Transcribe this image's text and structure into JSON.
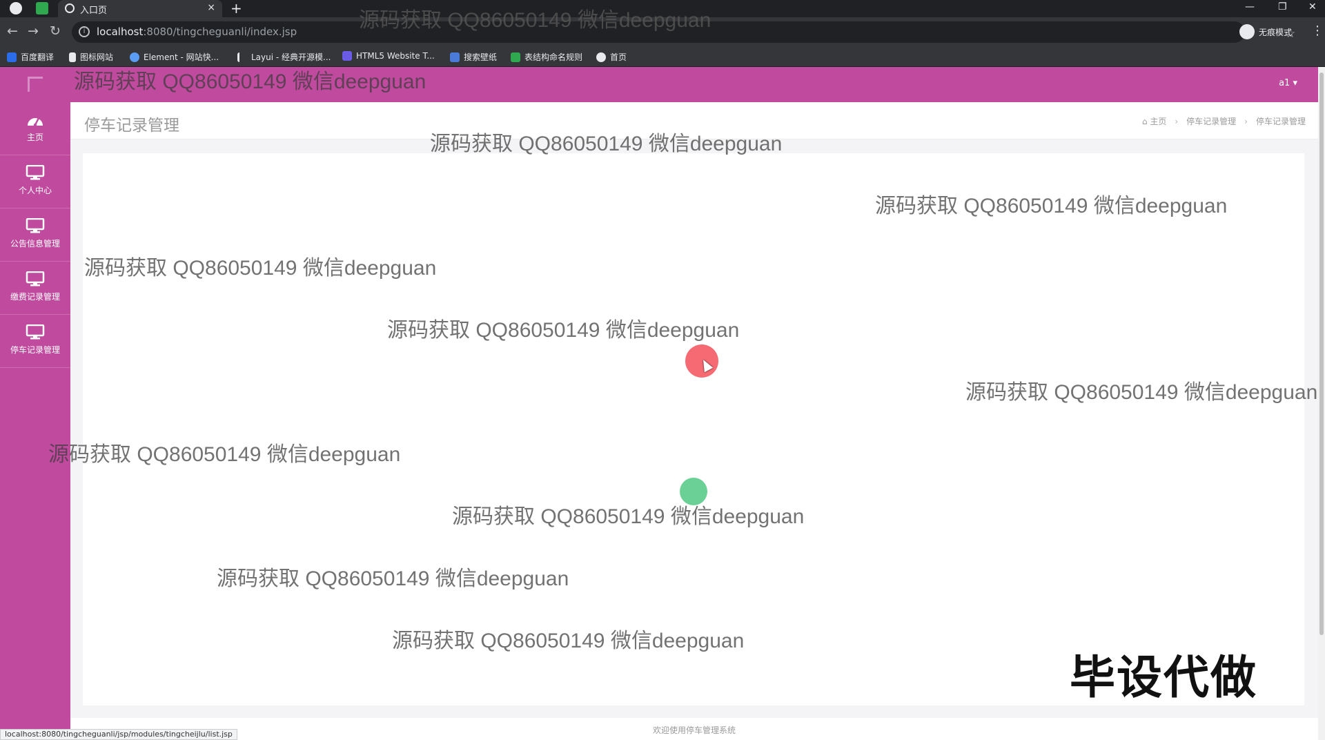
{
  "browser": {
    "tab_title": "入口页",
    "tab_close": "×",
    "new_tab": "+",
    "url_host": "localhost",
    "url_path": ":8080/tingcheguanli/index.jsp",
    "incognito_label": "无痕模式",
    "bookmarks": [
      {
        "label": "百度翻译",
        "color": "#2b6de8"
      },
      {
        "label": "图标网站",
        "color": "#e8eaed"
      },
      {
        "label": "Element - 网站快...",
        "color": "#5b9cf5"
      },
      {
        "label": "Layui - 经典开源模...",
        "color": "#e8eaed"
      },
      {
        "label": "HTML5 Website T...",
        "color": "#6b5ce7"
      },
      {
        "label": "搜索壁纸",
        "color": "#4a7bd8"
      },
      {
        "label": "表结构命名规则",
        "color": "#2fa84f"
      },
      {
        "label": "首页",
        "color": "#e8eaed"
      }
    ]
  },
  "topnav": {
    "user": "a1 ▾"
  },
  "sidebar": {
    "items": [
      {
        "label": "主页",
        "icon": "dashboard-icon"
      },
      {
        "label": "个人中心",
        "icon": "monitor-icon"
      },
      {
        "label": "公告信息管理",
        "icon": "monitor-icon"
      },
      {
        "label": "缴费记录管理",
        "icon": "monitor-icon"
      },
      {
        "label": "停车记录管理",
        "icon": "monitor-icon"
      }
    ]
  },
  "page": {
    "title": "停车记录管理",
    "breadcrumb": [
      "主页",
      "停车记录管理",
      "停车记录管理"
    ],
    "breadcrumb_sep": "›",
    "footer": "欢迎使用停车管理系统"
  },
  "status_url": "localhost:8080/tingcheguanli/jsp/modules/tingcheijlu/list.jsp",
  "watermark": {
    "text": "源码获取 QQ86050149 微信deepguan",
    "stamp": "毕设代做"
  },
  "colors": {
    "brand": "#bf4a9e",
    "chrome_dark": "#202124",
    "chrome": "#35363a"
  }
}
